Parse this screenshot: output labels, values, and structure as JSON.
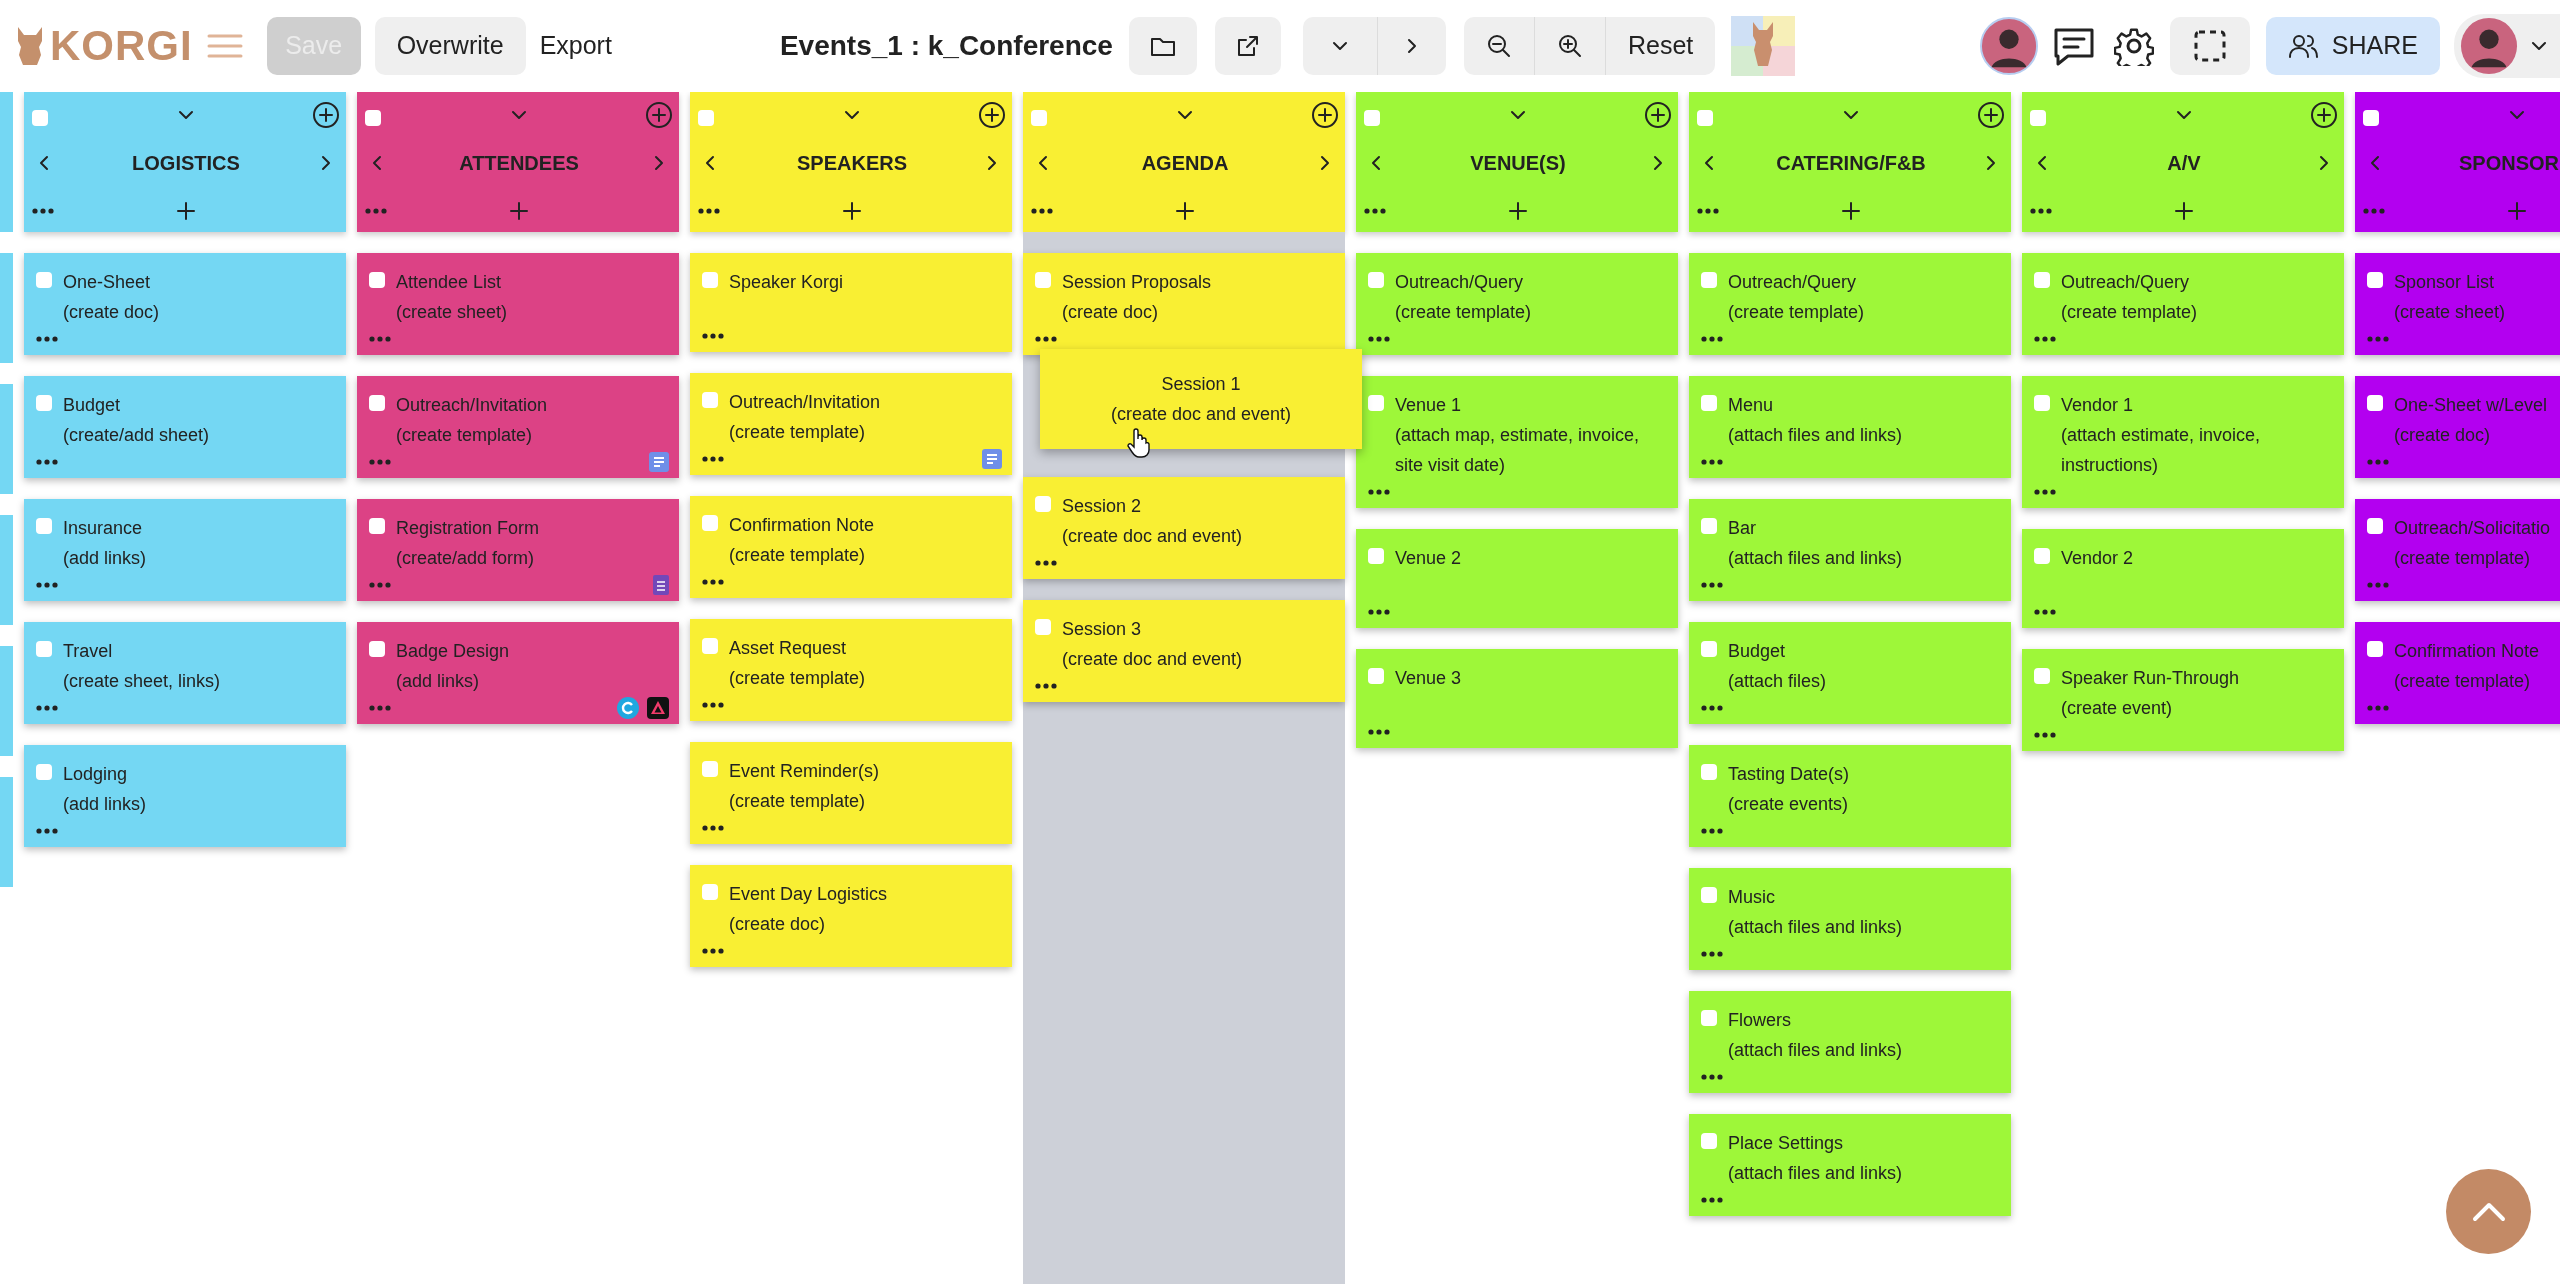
{
  "toolbar": {
    "logo": "KORGI",
    "buttons": [
      {
        "label": "Save",
        "disabled": true
      },
      {
        "label": "Overwrite",
        "disabled": false
      }
    ],
    "export": "Export",
    "title": "Events_1 : k_Conference",
    "reset": "Reset",
    "share": "SHARE"
  },
  "columns": [
    {
      "title": "LOGISTICS",
      "color": "#74d7f3",
      "checked": false,
      "drop_target": false,
      "cards": [
        {
          "title": "One-Sheet",
          "note": "(create doc)",
          "checked": false
        },
        {
          "title": "Budget",
          "note": "(create/add sheet)",
          "checked": false
        },
        {
          "title": "Insurance",
          "note": "(add links)",
          "checked": false
        },
        {
          "title": "Travel",
          "note": "(create sheet, links)",
          "checked": false
        },
        {
          "title": "Lodging",
          "note": "(add links)",
          "checked": false
        }
      ]
    },
    {
      "title": "ATTENDEES",
      "color": "#dc4285",
      "checked": false,
      "drop_target": false,
      "cards": [
        {
          "title": "Attendee List",
          "note": "(create sheet)",
          "checked": false
        },
        {
          "title": "Outreach/Invitation",
          "note": "(create template)",
          "checked": false,
          "attachments": [
            {
              "kind": "doc"
            }
          ]
        },
        {
          "title": "Registration Form",
          "note": "(create/add form)",
          "checked": false,
          "attachments": [
            {
              "kind": "form"
            }
          ]
        },
        {
          "title": "Badge Design",
          "note": "(add links)",
          "checked": false,
          "attachments": [
            {
              "kind": "canva"
            },
            {
              "kind": "express"
            }
          ]
        }
      ]
    },
    {
      "title": "SPEAKERS",
      "color": "#f9ef33",
      "checked": false,
      "drop_target": false,
      "cards": [
        {
          "title": "Speaker Korgi",
          "checked": false
        },
        {
          "title": "Outreach/Invitation",
          "note": "(create template)",
          "checked": false,
          "attachments": [
            {
              "kind": "doc"
            }
          ]
        },
        {
          "title": "Confirmation Note",
          "note": "(create template)",
          "checked": false
        },
        {
          "title": "Asset Request",
          "note": "(create template)",
          "checked": false
        },
        {
          "title": "Event Reminder(s)",
          "note": "(create template)",
          "checked": false
        },
        {
          "title": "Event Day Logistics",
          "note": "(create doc)",
          "checked": false
        }
      ]
    },
    {
      "title": "AGENDA",
      "color": "#f9ef33",
      "checked": false,
      "drop_target": true,
      "cards": [
        {
          "title": "Session Proposals",
          "note": "(create doc)",
          "checked": false
        },
        {
          "title": "Session 2",
          "note": "(create doc and event)",
          "checked": false
        },
        {
          "title": "Session 3",
          "note": "(create doc and event)",
          "checked": false
        }
      ]
    },
    {
      "title": "VENUE(S)",
      "color": "#9ef739",
      "checked": false,
      "drop_target": false,
      "cards": [
        {
          "title": "Outreach/Query",
          "note": "(create template)",
          "checked": false
        },
        {
          "title": "Venue 1",
          "note": "(attach map, estimate, invoice, site visit date)",
          "checked": false
        },
        {
          "title": "Venue 2",
          "checked": false
        },
        {
          "title": "Venue 3",
          "checked": false
        }
      ]
    },
    {
      "title": "CATERING/F&B",
      "color": "#9ef739",
      "checked": false,
      "drop_target": false,
      "cards": [
        {
          "title": "Outreach/Query",
          "note": "(create template)",
          "checked": false
        },
        {
          "title": "Menu",
          "note": "(attach files and links)",
          "checked": false
        },
        {
          "title": "Bar",
          "note": "(attach files and links)",
          "checked": false
        },
        {
          "title": "Budget",
          "note": "(attach files)",
          "checked": false
        },
        {
          "title": "Tasting Date(s)",
          "note": "(create events)",
          "checked": false
        },
        {
          "title": "Music",
          "note": "(attach files and links)",
          "checked": false
        },
        {
          "title": "Flowers",
          "note": "(attach files and links)",
          "checked": false
        },
        {
          "title": "Place Settings",
          "note": "(attach files and links)",
          "checked": false
        }
      ]
    },
    {
      "title": "A/V",
      "color": "#9ef739",
      "checked": false,
      "drop_target": false,
      "cards": [
        {
          "title": "Outreach/Query",
          "note": "(create template)",
          "checked": false
        },
        {
          "title": "Vendor 1",
          "note": "(attach estimate, invoice, instructions)",
          "checked": false
        },
        {
          "title": "Vendor 2",
          "checked": false
        },
        {
          "title": "Speaker Run-Through",
          "note": "(create event)",
          "checked": false
        }
      ]
    },
    {
      "title": "SPONSOR",
      "color": "#b300f0",
      "checked": false,
      "drop_target": false,
      "cards": [
        {
          "title": "Sponsor List",
          "note": "(create sheet)",
          "checked": false
        },
        {
          "title": "One-Sheet w/Level",
          "note": "(create doc)",
          "checked": false
        },
        {
          "title": "Outreach/Solicitatio",
          "note": "(create template)",
          "checked": false
        },
        {
          "title": "Confirmation Note",
          "note": "(create template)",
          "checked": false
        }
      ]
    }
  ],
  "dragged_card": {
    "title": "Session 1",
    "note": "(create doc and event)"
  }
}
